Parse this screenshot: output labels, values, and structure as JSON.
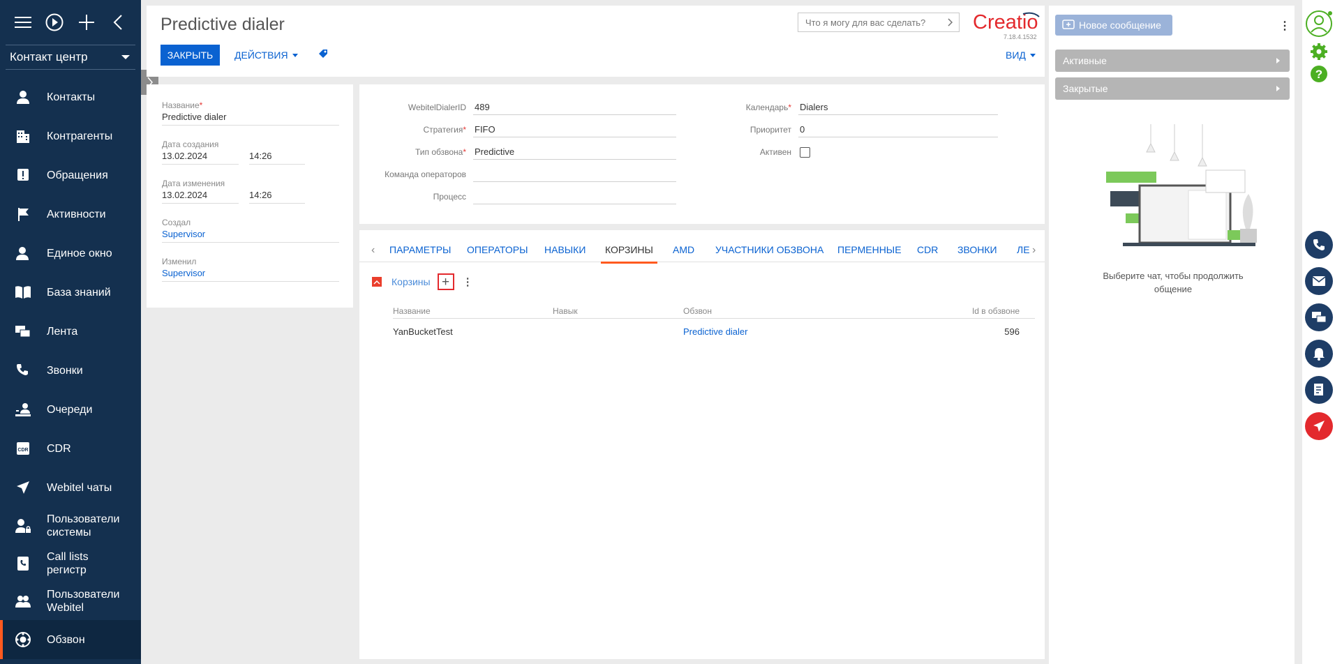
{
  "nav": {
    "section": "Контакт центр",
    "items": [
      {
        "label": "Контакты",
        "icon": "person-icon"
      },
      {
        "label": "Контрагенты",
        "icon": "building-icon"
      },
      {
        "label": "Обращения",
        "icon": "alert-icon"
      },
      {
        "label": "Активности",
        "icon": "flag-icon"
      },
      {
        "label": "Единое окно",
        "icon": "person-window-icon"
      },
      {
        "label": "База знаний",
        "icon": "book-icon"
      },
      {
        "label": "Лента",
        "icon": "chat-bubbles-icon"
      },
      {
        "label": "Звонки",
        "icon": "phone-icon"
      },
      {
        "label": "Очереди",
        "icon": "queue-icon"
      },
      {
        "label": "CDR",
        "icon": "cdr-icon"
      },
      {
        "label": "Webitel чаты",
        "icon": "send-icon"
      },
      {
        "label": "Пользователи системы",
        "icon": "user-lock-icon"
      },
      {
        "label": "Call lists регистр",
        "icon": "phone-book-icon"
      },
      {
        "label": "Пользователи Webitel",
        "icon": "users-icon"
      },
      {
        "label": "Обзвон",
        "icon": "dialer-icon"
      }
    ]
  },
  "header": {
    "title": "Predictive dialer",
    "close": "ЗАКРЫТЬ",
    "actions": "ДЕЙСТВИЯ",
    "view": "ВИД",
    "search_placeholder": "Что я могу для вас сделать?",
    "version": "7.18.4.1532",
    "logo": "Creatio"
  },
  "card": {
    "name_label": "Название",
    "name": "Predictive dialer",
    "created_label": "Дата создания",
    "created_date": "13.02.2024",
    "created_time": "14:26",
    "modified_label": "Дата изменения",
    "modified_date": "13.02.2024",
    "modified_time": "14:26",
    "author_label": "Создал",
    "author": "Supervisor",
    "editor_label": "Изменил",
    "editor": "Supervisor"
  },
  "main": {
    "dialer_id_label": "WebitelDialerID",
    "dialer_id": "489",
    "strategy_label": "Стратегия",
    "strategy": "FIFO",
    "type_label": "Тип обзвона",
    "type": "Predictive",
    "team_label": "Команда операторов",
    "team": "",
    "process_label": "Процесс",
    "process": "",
    "calendar_label": "Календарь",
    "calendar": "Dialers",
    "priority_label": "Приоритет",
    "priority": "0",
    "active_label": "Активен",
    "active": false
  },
  "tabs": [
    "ПАРАМЕТРЫ",
    "ОПЕРАТОРЫ",
    "НАВЫКИ",
    "КОРЗИНЫ",
    "AMD",
    "УЧАСТНИКИ ОБЗВОНА",
    "ПЕРМЕННЫЕ",
    "CDR",
    "ЗВОНКИ",
    "ЛЕ"
  ],
  "active_tab": "КОРЗИНЫ",
  "detail": {
    "title": "Корзины",
    "columns": [
      "Название",
      "Навык",
      "Обзвон",
      "Id в обзвоне"
    ],
    "rows": [
      {
        "name": "YanBucketTest",
        "skill": "",
        "dialer": "Predictive dialer",
        "id": "596"
      }
    ]
  },
  "comm": {
    "new_message": "Новое сообщение",
    "active": "Активные",
    "closed": "Закрытые",
    "empty_text": "Выберите чат, чтобы продолжить общение"
  },
  "colors": {
    "nav_bg": "#14304f",
    "accent": "#ff5a1f",
    "primary": "#0a62d1",
    "comm_btn": "#1e3d66",
    "danger": "#e3292d",
    "green": "#4caf23"
  }
}
